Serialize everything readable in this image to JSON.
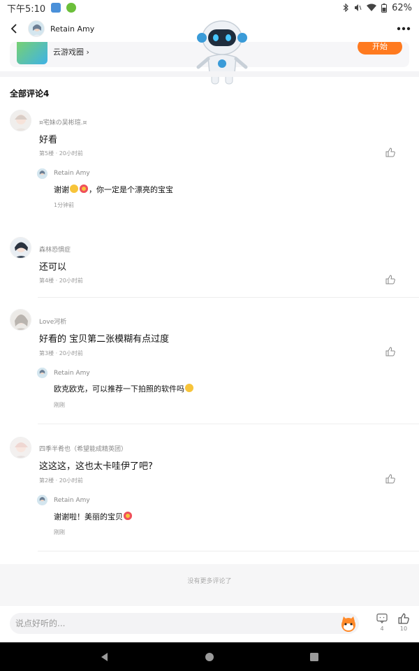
{
  "status_bar": {
    "time": "下午5:10",
    "battery": "62%"
  },
  "header": {
    "name": "Retain Amy"
  },
  "game_card": {
    "link_label": "云游戏圈",
    "start_label": "开始"
  },
  "section_title": "全部评论4",
  "comments": [
    {
      "user": "¤宅妹の吴彬瑄.¤",
      "text": "好看",
      "meta": "第5楼 · 20小时前",
      "reply": {
        "user": "Retain Amy",
        "text_prefix": "谢谢",
        "text_suffix": "，你一定是个漂亮的宝宝",
        "meta": "1分钟前"
      }
    },
    {
      "user": "森林恐惧症",
      "text": "还可以",
      "meta": "第4楼 · 20小时前"
    },
    {
      "user": "Love河析",
      "text": "好看的 宝贝第二张模糊有点过度",
      "meta": "第3楼 · 20小时前",
      "reply": {
        "user": "Retain Amy",
        "text_prefix": "欧克欧克，可以推荐一下拍照的软件吗",
        "text_suffix": "",
        "meta": "刚刚"
      }
    },
    {
      "user": "四季半肴也（希望能成精英团）",
      "text": "这这这，这也太卡哇伊了吧?",
      "meta": "第2楼 · 20小时前",
      "reply": {
        "user": "Retain Amy",
        "text_prefix": "谢谢啦！美丽的宝贝",
        "text_suffix": "",
        "meta": "刚刚"
      }
    }
  ],
  "no_more": "没有更多评论了",
  "bottom_bar": {
    "placeholder": "说点好听的...",
    "comment_count": "4",
    "like_count": "10"
  },
  "icons": [
    "back-icon",
    "more-icon",
    "robot-mascot-icon",
    "chevron-right-icon",
    "like-icon",
    "comment-icon",
    "mascot-face-icon",
    "nav-back-icon",
    "nav-home-icon",
    "nav-recents-icon"
  ],
  "colors": {
    "accent": "#ff7a1f",
    "divider": "#eeeeee",
    "muted": "#999999"
  }
}
